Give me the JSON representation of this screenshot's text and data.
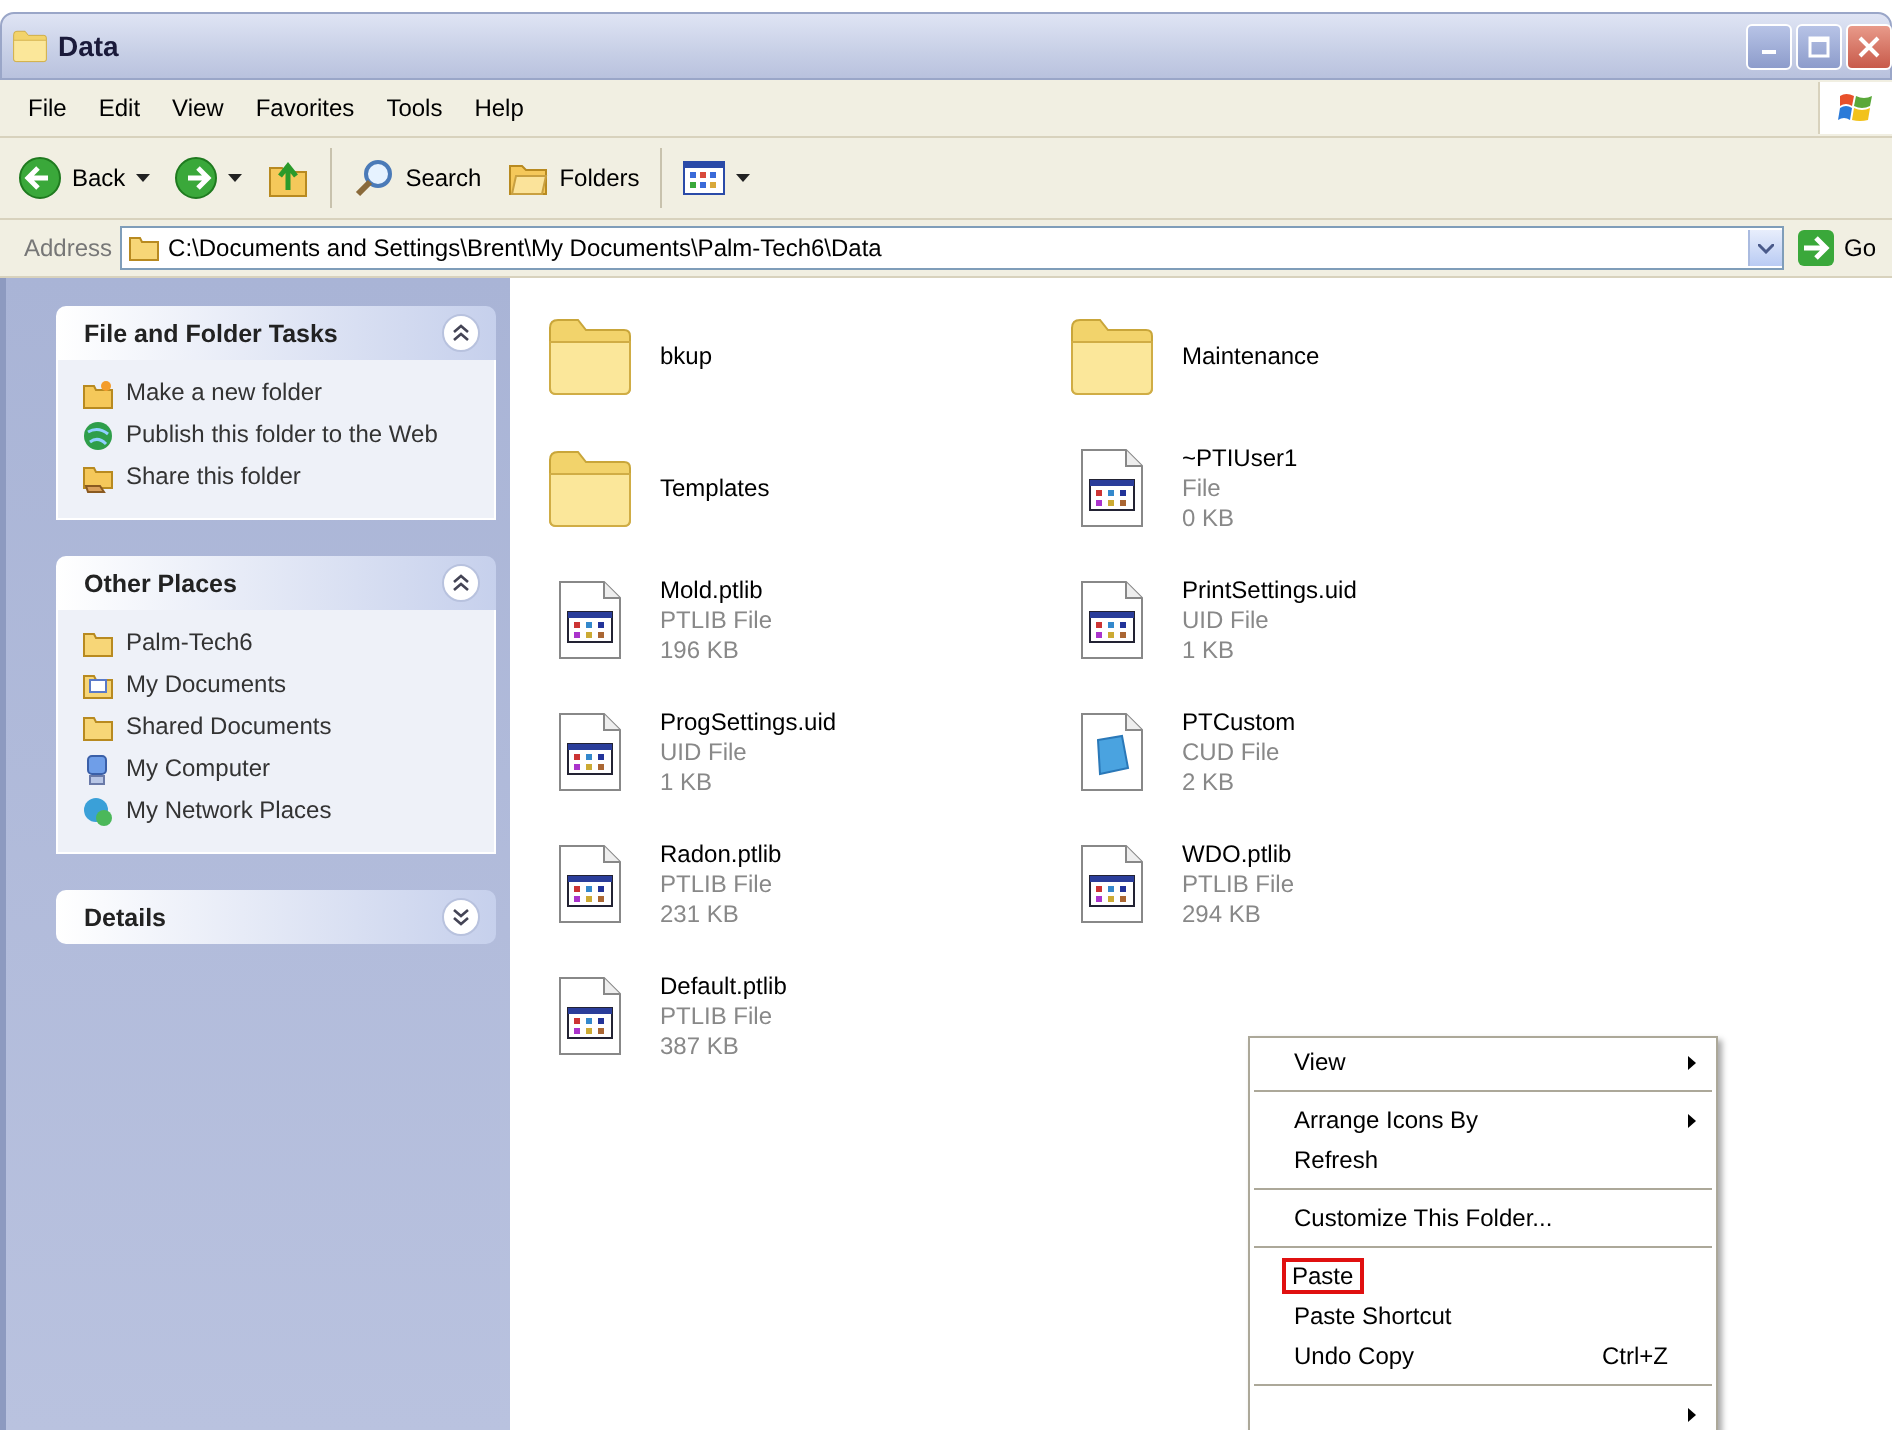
{
  "window": {
    "title": "Data"
  },
  "menu_bar": [
    "File",
    "Edit",
    "View",
    "Favorites",
    "Tools",
    "Help"
  ],
  "toolbar": [
    {
      "kind": "back",
      "label": "Back",
      "dropdown": true
    },
    {
      "kind": "forward",
      "dropdown": true
    },
    {
      "kind": "up",
      "dropdown": false
    },
    {
      "kind": "search",
      "label": "Search",
      "dropdown": false
    },
    {
      "kind": "folders",
      "label": "Folders",
      "dropdown": false
    },
    {
      "kind": "views",
      "dropdown": true
    }
  ],
  "address": {
    "label": "Address",
    "value": "C:\\Documents and Settings\\Brent\\My Documents\\Palm-Tech6\\Data",
    "go": "Go"
  },
  "sidebar": [
    {
      "title": "File and Folder Tasks",
      "expanded": true,
      "items": [
        "Make a new folder",
        "Publish this folder to the Web",
        "Share this folder"
      ]
    },
    {
      "title": "Other Places",
      "expanded": true,
      "items": [
        "Palm-Tech6",
        "My Documents",
        "Shared Documents",
        "My Computer",
        "My Network Places"
      ]
    },
    {
      "title": "Details",
      "expanded": false
    }
  ],
  "files": [
    {
      "kind": "folder",
      "name": "bkup"
    },
    {
      "kind": "folder",
      "name": "Templates"
    },
    {
      "kind": "program",
      "name": "Mold.ptlib",
      "type": "PTLIB File",
      "size": "196 KB"
    },
    {
      "kind": "program",
      "name": "ProgSettings.uid",
      "type": "UID File",
      "size": "1 KB"
    },
    {
      "kind": "program",
      "name": "Radon.ptlib",
      "type": "PTLIB File",
      "size": "231 KB"
    },
    {
      "kind": "program",
      "name": "Default.ptlib",
      "type": "PTLIB File",
      "size": "387 KB"
    },
    {
      "kind": "folder",
      "name": "Maintenance"
    },
    {
      "kind": "program",
      "name": "~PTIUser1",
      "type": "File",
      "size": "0 KB"
    },
    {
      "kind": "program",
      "name": "PrintSettings.uid",
      "type": "UID File",
      "size": "1 KB"
    },
    {
      "kind": "document",
      "name": "PTCustom",
      "type": "CUD File",
      "size": "2 KB"
    },
    {
      "kind": "program",
      "name": "WDO.ptlib",
      "type": "PTLIB File",
      "size": "294 KB"
    }
  ],
  "context_menu": [
    {
      "kind": "item",
      "label": "View",
      "submenu": true,
      "highlighted": false
    },
    {
      "kind": "separator"
    },
    {
      "kind": "item",
      "label": "Arrange Icons By",
      "submenu": true,
      "highlighted": false
    },
    {
      "kind": "item",
      "label": "Refresh",
      "submenu": false,
      "highlighted": false
    },
    {
      "kind": "separator"
    },
    {
      "kind": "item",
      "label": "Customize This Folder...",
      "submenu": false,
      "highlighted": false
    },
    {
      "kind": "separator"
    },
    {
      "kind": "item",
      "label": "Paste",
      "submenu": false,
      "highlighted": true
    },
    {
      "kind": "item",
      "label": "Paste Shortcut",
      "submenu": false,
      "highlighted": false
    },
    {
      "kind": "item",
      "label": "Undo Copy",
      "shortcut": "Ctrl+Z",
      "submenu": false,
      "highlighted": false
    },
    {
      "kind": "separator"
    },
    {
      "kind": "item",
      "submenu": true,
      "highlighted": false
    }
  ]
}
